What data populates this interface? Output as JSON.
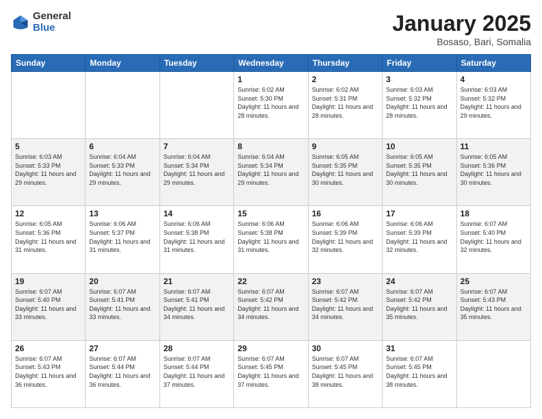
{
  "header": {
    "logo": {
      "general": "General",
      "blue": "Blue"
    },
    "title": "January 2025",
    "location": "Bosaso, Bari, Somalia"
  },
  "weekdays": [
    "Sunday",
    "Monday",
    "Tuesday",
    "Wednesday",
    "Thursday",
    "Friday",
    "Saturday"
  ],
  "rows": [
    {
      "gray": false,
      "cells": [
        {
          "day": "",
          "sunrise": "",
          "sunset": "",
          "daylight": ""
        },
        {
          "day": "",
          "sunrise": "",
          "sunset": "",
          "daylight": ""
        },
        {
          "day": "",
          "sunrise": "",
          "sunset": "",
          "daylight": ""
        },
        {
          "day": "1",
          "sunrise": "Sunrise: 6:02 AM",
          "sunset": "Sunset: 5:30 PM",
          "daylight": "Daylight: 11 hours and 28 minutes."
        },
        {
          "day": "2",
          "sunrise": "Sunrise: 6:02 AM",
          "sunset": "Sunset: 5:31 PM",
          "daylight": "Daylight: 11 hours and 28 minutes."
        },
        {
          "day": "3",
          "sunrise": "Sunrise: 6:03 AM",
          "sunset": "Sunset: 5:32 PM",
          "daylight": "Daylight: 11 hours and 28 minutes."
        },
        {
          "day": "4",
          "sunrise": "Sunrise: 6:03 AM",
          "sunset": "Sunset: 5:32 PM",
          "daylight": "Daylight: 11 hours and 29 minutes."
        }
      ]
    },
    {
      "gray": true,
      "cells": [
        {
          "day": "5",
          "sunrise": "Sunrise: 6:03 AM",
          "sunset": "Sunset: 5:33 PM",
          "daylight": "Daylight: 11 hours and 29 minutes."
        },
        {
          "day": "6",
          "sunrise": "Sunrise: 6:04 AM",
          "sunset": "Sunset: 5:33 PM",
          "daylight": "Daylight: 11 hours and 29 minutes."
        },
        {
          "day": "7",
          "sunrise": "Sunrise: 6:04 AM",
          "sunset": "Sunset: 5:34 PM",
          "daylight": "Daylight: 11 hours and 29 minutes."
        },
        {
          "day": "8",
          "sunrise": "Sunrise: 6:04 AM",
          "sunset": "Sunset: 5:34 PM",
          "daylight": "Daylight: 11 hours and 29 minutes."
        },
        {
          "day": "9",
          "sunrise": "Sunrise: 6:05 AM",
          "sunset": "Sunset: 5:35 PM",
          "daylight": "Daylight: 11 hours and 30 minutes."
        },
        {
          "day": "10",
          "sunrise": "Sunrise: 6:05 AM",
          "sunset": "Sunset: 5:35 PM",
          "daylight": "Daylight: 11 hours and 30 minutes."
        },
        {
          "day": "11",
          "sunrise": "Sunrise: 6:05 AM",
          "sunset": "Sunset: 5:36 PM",
          "daylight": "Daylight: 11 hours and 30 minutes."
        }
      ]
    },
    {
      "gray": false,
      "cells": [
        {
          "day": "12",
          "sunrise": "Sunrise: 6:05 AM",
          "sunset": "Sunset: 5:36 PM",
          "daylight": "Daylight: 11 hours and 31 minutes."
        },
        {
          "day": "13",
          "sunrise": "Sunrise: 6:06 AM",
          "sunset": "Sunset: 5:37 PM",
          "daylight": "Daylight: 11 hours and 31 minutes."
        },
        {
          "day": "14",
          "sunrise": "Sunrise: 6:06 AM",
          "sunset": "Sunset: 5:38 PM",
          "daylight": "Daylight: 11 hours and 31 minutes."
        },
        {
          "day": "15",
          "sunrise": "Sunrise: 6:06 AM",
          "sunset": "Sunset: 5:38 PM",
          "daylight": "Daylight: 11 hours and 31 minutes."
        },
        {
          "day": "16",
          "sunrise": "Sunrise: 6:06 AM",
          "sunset": "Sunset: 5:39 PM",
          "daylight": "Daylight: 11 hours and 32 minutes."
        },
        {
          "day": "17",
          "sunrise": "Sunrise: 6:06 AM",
          "sunset": "Sunset: 5:39 PM",
          "daylight": "Daylight: 11 hours and 32 minutes."
        },
        {
          "day": "18",
          "sunrise": "Sunrise: 6:07 AM",
          "sunset": "Sunset: 5:40 PM",
          "daylight": "Daylight: 11 hours and 32 minutes."
        }
      ]
    },
    {
      "gray": true,
      "cells": [
        {
          "day": "19",
          "sunrise": "Sunrise: 6:07 AM",
          "sunset": "Sunset: 5:40 PM",
          "daylight": "Daylight: 11 hours and 33 minutes."
        },
        {
          "day": "20",
          "sunrise": "Sunrise: 6:07 AM",
          "sunset": "Sunset: 5:41 PM",
          "daylight": "Daylight: 11 hours and 33 minutes."
        },
        {
          "day": "21",
          "sunrise": "Sunrise: 6:07 AM",
          "sunset": "Sunset: 5:41 PM",
          "daylight": "Daylight: 11 hours and 34 minutes."
        },
        {
          "day": "22",
          "sunrise": "Sunrise: 6:07 AM",
          "sunset": "Sunset: 5:42 PM",
          "daylight": "Daylight: 11 hours and 34 minutes."
        },
        {
          "day": "23",
          "sunrise": "Sunrise: 6:07 AM",
          "sunset": "Sunset: 5:42 PM",
          "daylight": "Daylight: 11 hours and 34 minutes."
        },
        {
          "day": "24",
          "sunrise": "Sunrise: 6:07 AM",
          "sunset": "Sunset: 5:42 PM",
          "daylight": "Daylight: 11 hours and 35 minutes."
        },
        {
          "day": "25",
          "sunrise": "Sunrise: 6:07 AM",
          "sunset": "Sunset: 5:43 PM",
          "daylight": "Daylight: 11 hours and 35 minutes."
        }
      ]
    },
    {
      "gray": false,
      "cells": [
        {
          "day": "26",
          "sunrise": "Sunrise: 6:07 AM",
          "sunset": "Sunset: 5:43 PM",
          "daylight": "Daylight: 11 hours and 36 minutes."
        },
        {
          "day": "27",
          "sunrise": "Sunrise: 6:07 AM",
          "sunset": "Sunset: 5:44 PM",
          "daylight": "Daylight: 11 hours and 36 minutes."
        },
        {
          "day": "28",
          "sunrise": "Sunrise: 6:07 AM",
          "sunset": "Sunset: 5:44 PM",
          "daylight": "Daylight: 11 hours and 37 minutes."
        },
        {
          "day": "29",
          "sunrise": "Sunrise: 6:07 AM",
          "sunset": "Sunset: 5:45 PM",
          "daylight": "Daylight: 11 hours and 37 minutes."
        },
        {
          "day": "30",
          "sunrise": "Sunrise: 6:07 AM",
          "sunset": "Sunset: 5:45 PM",
          "daylight": "Daylight: 11 hours and 38 minutes."
        },
        {
          "day": "31",
          "sunrise": "Sunrise: 6:07 AM",
          "sunset": "Sunset: 5:45 PM",
          "daylight": "Daylight: 11 hours and 38 minutes."
        },
        {
          "day": "",
          "sunrise": "",
          "sunset": "",
          "daylight": ""
        }
      ]
    }
  ]
}
